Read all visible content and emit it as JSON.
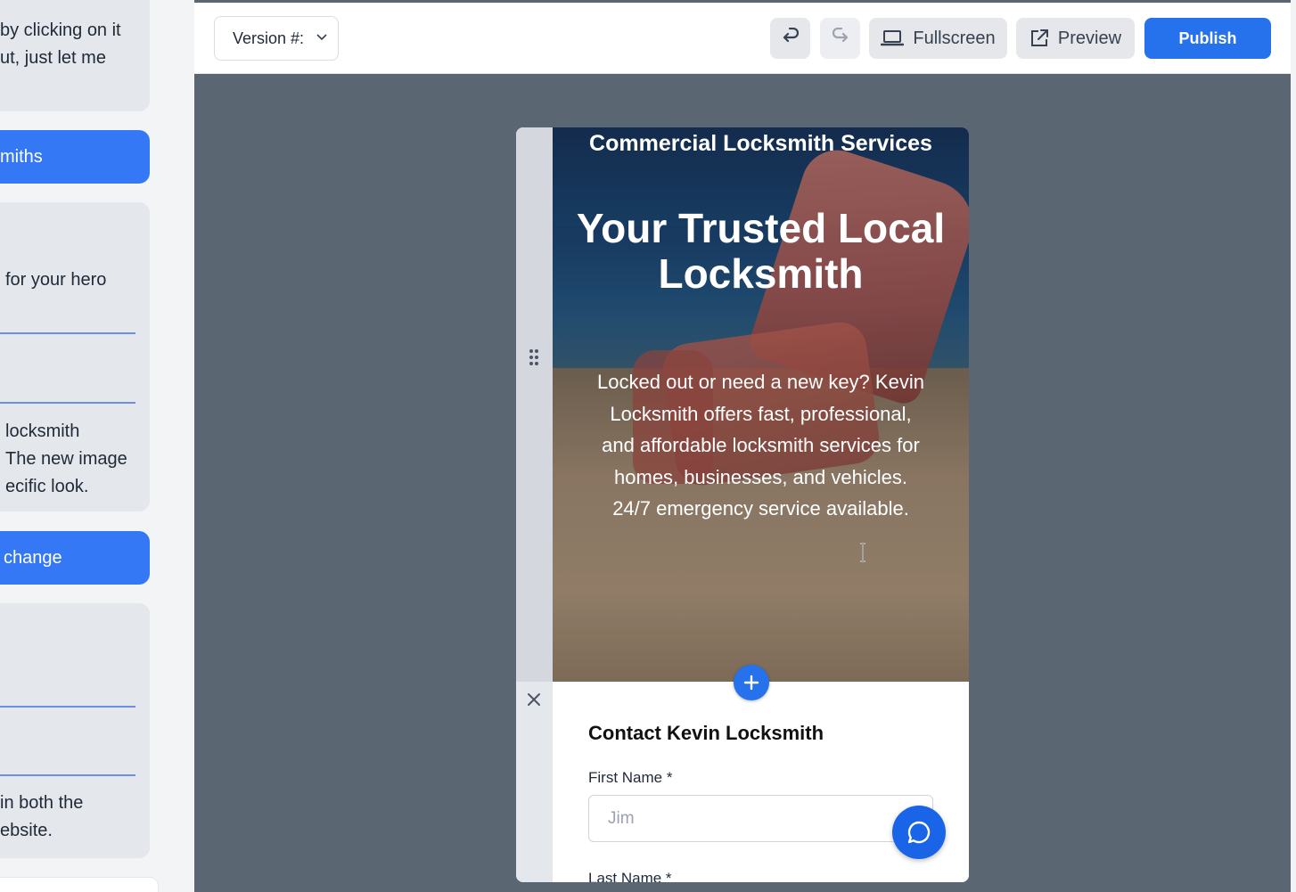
{
  "chat": {
    "messages": [
      {
        "type": "assistant",
        "lines": [
          "by clicking on it",
          "ut, just let me"
        ]
      },
      {
        "type": "user",
        "lines": [
          "miths"
        ]
      },
      {
        "type": "assistant",
        "lines": [
          "for your hero"
        ]
      },
      {
        "type": "assistant",
        "lines": [
          "locksmith",
          "The new image",
          "ecific look."
        ]
      },
      {
        "type": "user",
        "lines": [
          "change"
        ]
      },
      {
        "type": "assistant",
        "lines": [
          "in both the",
          "ebsite."
        ]
      }
    ]
  },
  "toolbar": {
    "version_label": "Version #:",
    "fullscreen_label": "Fullscreen",
    "preview_label": "Preview",
    "publish_label": "Publish"
  },
  "hero": {
    "subtitle": "Commercial Locksmith Services",
    "title": "Your Trusted Local Locksmith",
    "description": "Locked out or need a new key? Kevin Locksmith offers fast, professional, and affordable locksmith services for homes, businesses, and vehicles. 24/7 emergency service available."
  },
  "form": {
    "title": "Contact Kevin Locksmith",
    "first_name_label": "First Name *",
    "first_name_placeholder": "Jim",
    "last_name_label": "Last Name *"
  },
  "colors": {
    "accent": "#2672ec",
    "editor_bg": "#5a6773"
  },
  "icons": [
    "chevron-down-icon",
    "undo-icon",
    "redo-icon",
    "laptop-icon",
    "external-link-icon",
    "drag-handle-icon",
    "close-icon",
    "plus-icon",
    "chat-icon",
    "text-cursor-icon"
  ]
}
